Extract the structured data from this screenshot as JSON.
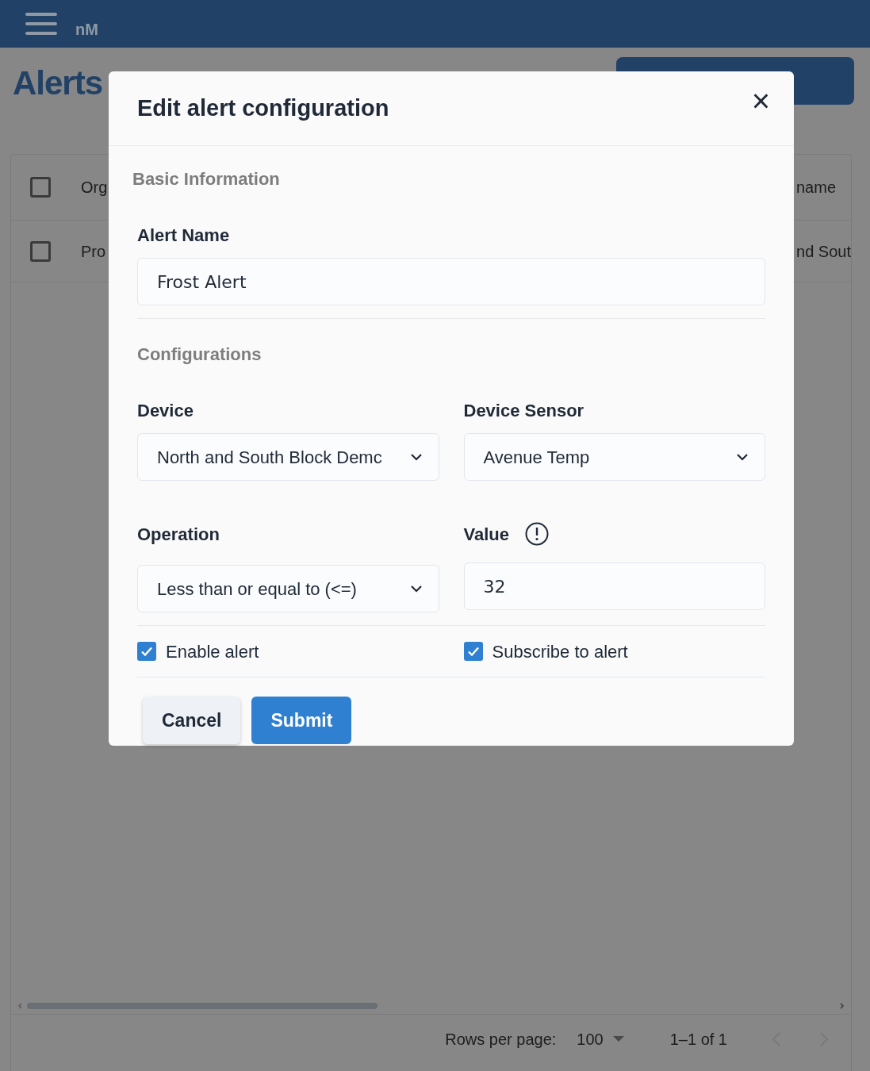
{
  "header": {
    "brand": "nM"
  },
  "page": {
    "title": "Alerts"
  },
  "table": {
    "all_checked": false,
    "columns": [
      "Org",
      "name"
    ],
    "rows": [
      {
        "checked": false,
        "cells": [
          "Pro",
          "nd Sout"
        ]
      }
    ]
  },
  "pagination": {
    "rows_per_page_label": "Rows per page:",
    "rows_per_page": "100",
    "range": "1–1 of 1"
  },
  "dialog": {
    "title": "Edit alert configuration",
    "close": "×",
    "basic_heading": "Basic Information",
    "alert_name": {
      "label": "Alert Name",
      "value": "Frost Alert"
    },
    "config_heading": "Configurations",
    "device": {
      "label": "Device",
      "value": "North and South Block Demc"
    },
    "device_sensor": {
      "label": "Device Sensor",
      "value": "Avenue Temp"
    },
    "operation": {
      "label": "Operation",
      "value": "Less than or equal to (<=)"
    },
    "value": {
      "label": "Value",
      "value": "32"
    },
    "checkboxes": [
      {
        "label": "Enable alert",
        "checked": true
      },
      {
        "label": "Subscribe to alert",
        "checked": true
      }
    ],
    "buttons": [
      {
        "label": "Cancel",
        "kind": "secondary"
      },
      {
        "label": "Submit",
        "kind": "primary"
      }
    ]
  }
}
